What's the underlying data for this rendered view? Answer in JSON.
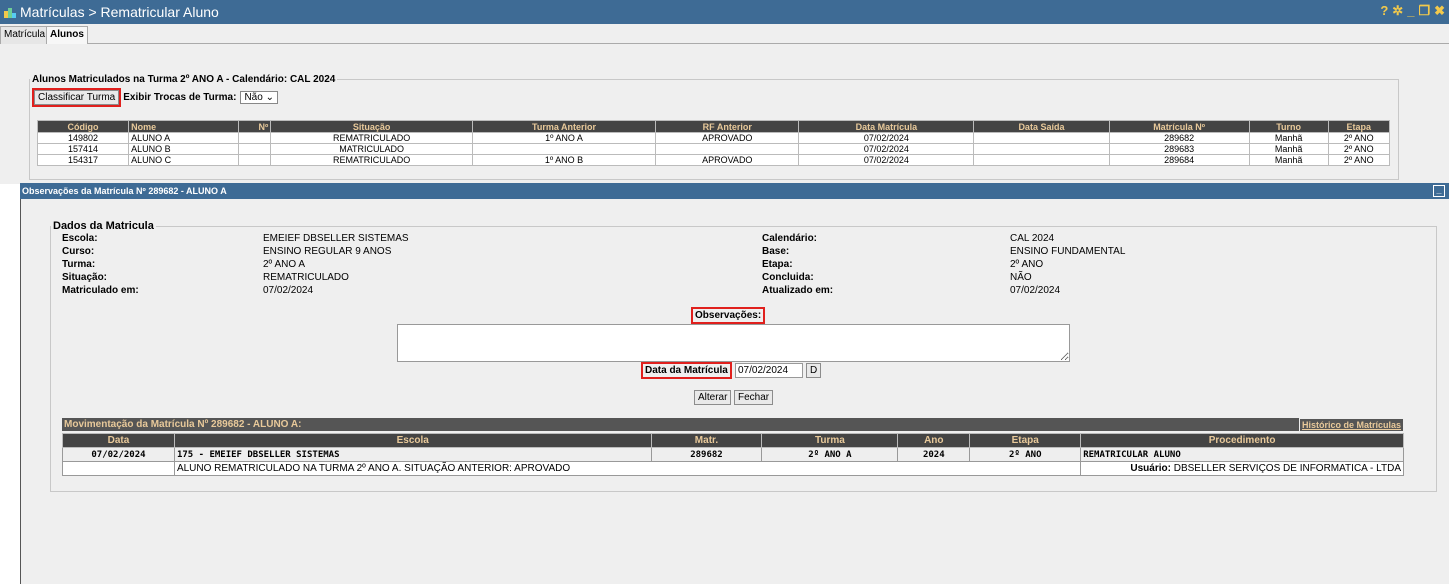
{
  "window": {
    "title": "Matrículas > Rematricular Aluno",
    "controls": [
      "help-icon",
      "gear-icon",
      "minimize-icon",
      "restore-icon",
      "close-icon"
    ]
  },
  "tabs": [
    {
      "label": "Matrícula",
      "active": false
    },
    {
      "label": "Alunos",
      "active": true
    }
  ],
  "students_panel": {
    "legend": "Alunos Matriculados na Turma 2º ANO A - Calendário: CAL 2024",
    "classify_button": "Classificar Turma",
    "show_changes_label": "Exibir Trocas de Turma:",
    "show_changes_value": "Não",
    "columns": [
      "Código",
      "Nome",
      "Nº",
      "Situação",
      "Turma Anterior",
      "RF Anterior",
      "Data Matrícula",
      "Data Saída",
      "Matrícula Nº",
      "Turno",
      "Etapa"
    ],
    "rows": [
      [
        "149802",
        "ALUNO A",
        "",
        "REMATRICULADO",
        "1º ANO A",
        "APROVADO",
        "07/02/2024",
        "",
        "289682",
        "Manhã",
        "2º ANO"
      ],
      [
        "157414",
        "ALUNO B",
        "",
        "MATRICULADO",
        "",
        "",
        "07/02/2024",
        "",
        "289683",
        "Manhã",
        "2º ANO"
      ],
      [
        "154317",
        "ALUNO C",
        "",
        "REMATRICULADO",
        "1º ANO B",
        "APROVADO",
        "07/02/2024",
        "",
        "289684",
        "Manhã",
        "2º ANO"
      ]
    ]
  },
  "dialog": {
    "title": "Observações da Matrícula Nº 289682 - ALUNO A",
    "legend": "Dados da Matricula",
    "left_fields": [
      {
        "label": "Escola:",
        "value": "EMEIEF DBSELLER SISTEMAS"
      },
      {
        "label": "Curso:",
        "value": "ENSINO REGULAR 9 ANOS"
      },
      {
        "label": "Turma:",
        "value": "2º ANO A"
      },
      {
        "label": "Situação:",
        "value": "REMATRICULADO"
      },
      {
        "label": "Matriculado em:",
        "value": "07/02/2024"
      }
    ],
    "right_fields": [
      {
        "label": "Calendário:",
        "value": "CAL 2024"
      },
      {
        "label": "Base:",
        "value": "ENSINO FUNDAMENTAL"
      },
      {
        "label": "Etapa:",
        "value": "2º ANO"
      },
      {
        "label": "Concluida:",
        "value": "NÃO"
      },
      {
        "label": "Atualizado em:",
        "value": "07/02/2024"
      }
    ],
    "observacoes_label": "Observações:",
    "observacoes_value": "",
    "data_matricula_label": "Data da Matrícula",
    "data_matricula_value": "07/02/2024",
    "date_picker_button": "D",
    "alterar_button": "Alterar",
    "fechar_button": "Fechar",
    "movimentacao": {
      "title": "Movimentação da Matrícula Nº 289682 - ALUNO A:",
      "history_link": "Histórico de Matrículas",
      "columns": [
        "Data",
        "Escola",
        "Matr.",
        "Turma",
        "Ano",
        "Etapa",
        "Procedimento"
      ],
      "row": [
        "07/02/2024",
        "175 - EMEIEF DBSELLER SISTEMAS",
        "289682",
        "2º ANO A",
        "2024",
        "2º ANO",
        "REMATRICULAR ALUNO"
      ],
      "note": "ALUNO REMATRICULADO NA TURMA 2º ANO A. SITUAÇÃO ANTERIOR: APROVADO",
      "user_label": "Usuário:",
      "user_value": "DBSELLER SERVIÇOS DE INFORMATICA - LTDA"
    }
  }
}
